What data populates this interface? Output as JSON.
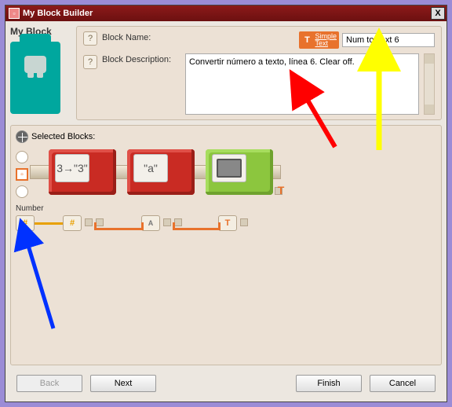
{
  "window": {
    "title": "My Block Builder"
  },
  "left": {
    "heading": "My Block"
  },
  "form": {
    "name_label": "Block Name:",
    "simple_text_link": "Simple\nText",
    "name_value": "Num to Text 6",
    "description_label": "Block Description:",
    "description_value": "Convertir número a texto, línea 6. Clear off."
  },
  "selected": {
    "heading": "Selected Blocks:"
  },
  "blocks": {
    "num2text_label": "3→\"3\"",
    "text_label": "\"a\"",
    "param_label": "Number"
  },
  "buttons": {
    "back": "Back",
    "next": "Next",
    "finish": "Finish",
    "cancel": "Cancel"
  },
  "annotations": {
    "red_arrow": {
      "target": "description-input",
      "color": "#ff0000"
    },
    "yellow_arrow": {
      "target": "block-name-input",
      "color": "#ffff00"
    },
    "blue_arrow": {
      "target": "number-parameter-node",
      "color": "#0031ff"
    }
  }
}
